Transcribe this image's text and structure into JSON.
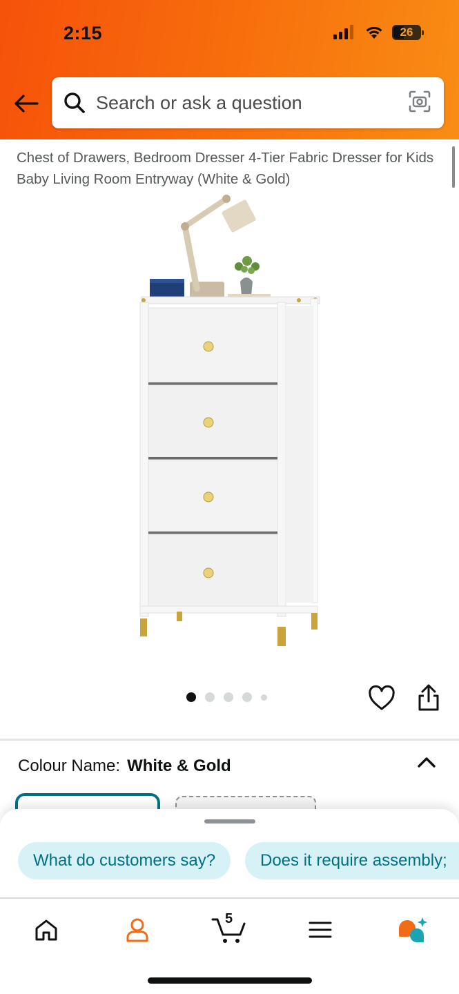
{
  "status_bar": {
    "time": "2:15",
    "battery": "26"
  },
  "search": {
    "placeholder": "Search or ask a question"
  },
  "product": {
    "title": "Chest of Drawers, Bedroom Dresser 4-Tier Fabric Dresser for Kids Baby Living Room Entryway (White & Gold)",
    "image_pager": {
      "count": 5,
      "active_index": 0
    }
  },
  "variation": {
    "label": "Colour Name:",
    "value": "White & Gold"
  },
  "suggestions": [
    "What do customers say?",
    "Does it require assembly;"
  ],
  "tabbar": {
    "cart_count": "5"
  },
  "colors": {
    "brand_orange": "#f76b0c",
    "teal": "#007185",
    "chip_bg": "#d6f2f7"
  }
}
